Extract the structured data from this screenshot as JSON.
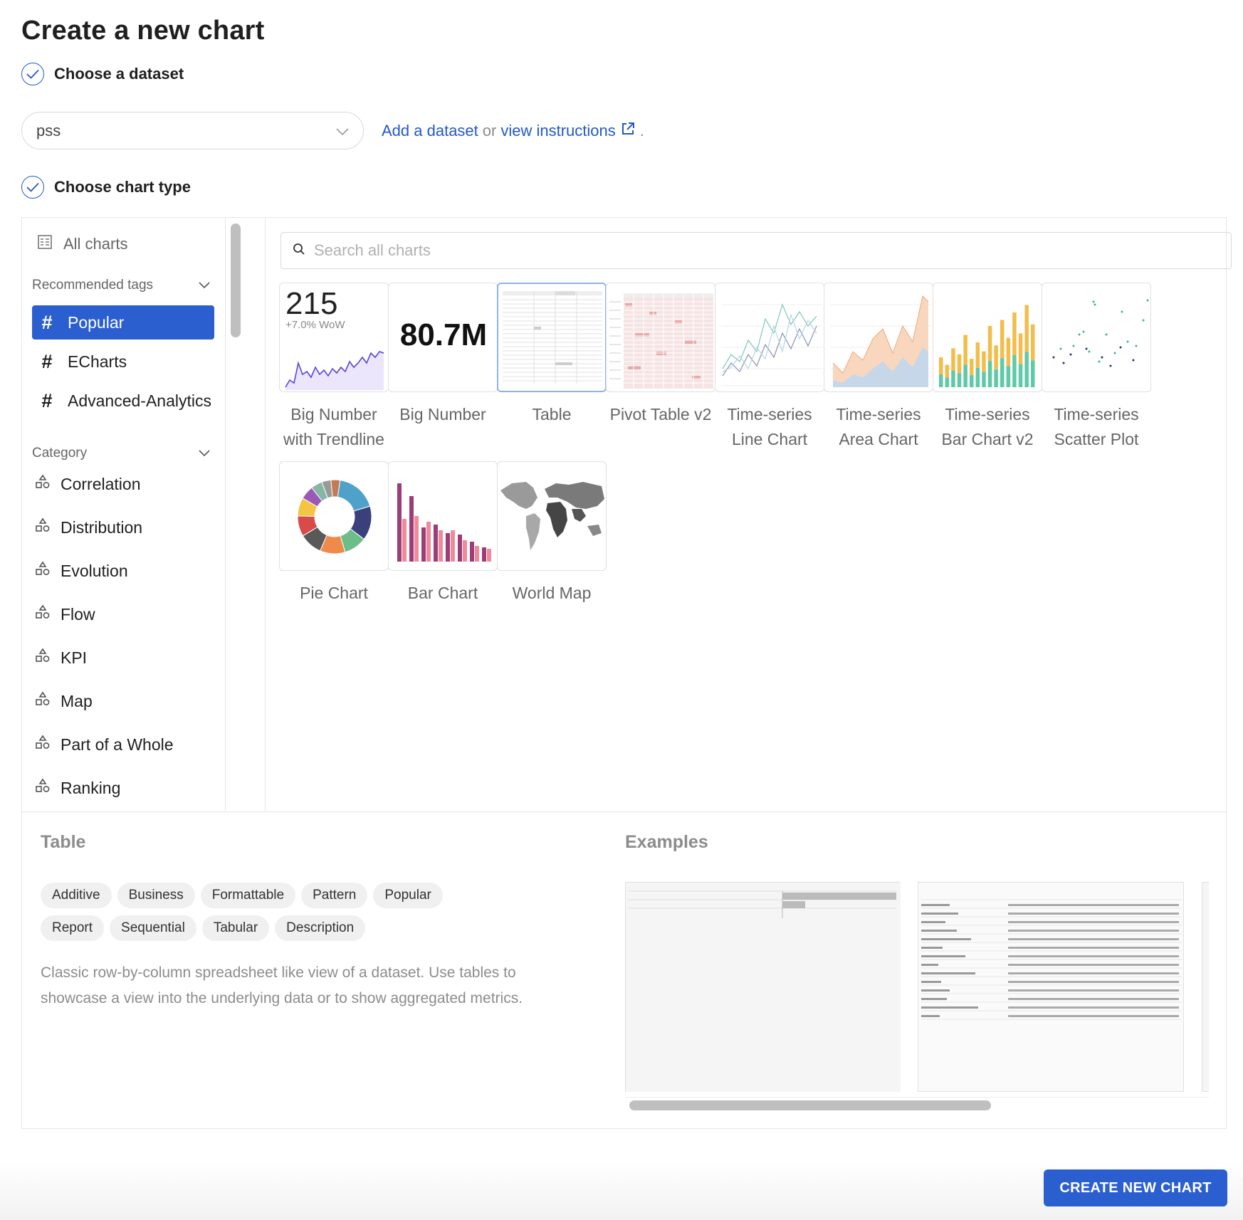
{
  "page": {
    "title": "Create a new chart"
  },
  "steps": {
    "dataset": "Choose a dataset",
    "chart_type": "Choose chart type"
  },
  "dataset": {
    "value": "pss",
    "add_link": "Add a dataset",
    "or": "or",
    "instructions_link": "view instructions",
    "period": "."
  },
  "sidebar": {
    "all_charts": "All charts",
    "recommended_tags_header": "Recommended tags",
    "tags": [
      "Popular",
      "ECharts",
      "Advanced-Analytics"
    ],
    "category_header": "Category",
    "categories": [
      "Correlation",
      "Distribution",
      "Evolution",
      "Flow",
      "KPI",
      "Map",
      "Part of a Whole",
      "Ranking"
    ]
  },
  "search": {
    "placeholder": "Search all charts"
  },
  "charts": [
    {
      "label1": "Big Number",
      "label2": "with Trendline",
      "thumb_text": "215",
      "thumb_sub": "+7.0% WoW"
    },
    {
      "label1": "Big Number",
      "label2": "",
      "thumb_text": "80.7M"
    },
    {
      "label1": "Table",
      "label2": ""
    },
    {
      "label1": "Pivot Table v2",
      "label2": ""
    },
    {
      "label1": "Time-series",
      "label2": "Line Chart"
    },
    {
      "label1": "Time-series",
      "label2": "Area Chart"
    },
    {
      "label1": "Time-series",
      "label2": "Bar Chart v2"
    },
    {
      "label1": "Time-series",
      "label2": "Scatter Plot"
    },
    {
      "label1": "Pie Chart",
      "label2": ""
    },
    {
      "label1": "Bar Chart",
      "label2": ""
    },
    {
      "label1": "World Map",
      "label2": ""
    }
  ],
  "details": {
    "title": "Table",
    "tags": [
      "Additive",
      "Business",
      "Formattable",
      "Pattern",
      "Popular",
      "Report",
      "Sequential",
      "Tabular",
      "Description"
    ],
    "description": "Classic row-by-column spreadsheet like view of a dataset. Use tables to showcase a view into the underlying data or to show aggregated metrics.",
    "examples_title": "Examples"
  },
  "footer": {
    "create_button": "CREATE NEW CHART"
  },
  "colors": {
    "accent": "#2b5fd0",
    "link": "#2358c7"
  }
}
